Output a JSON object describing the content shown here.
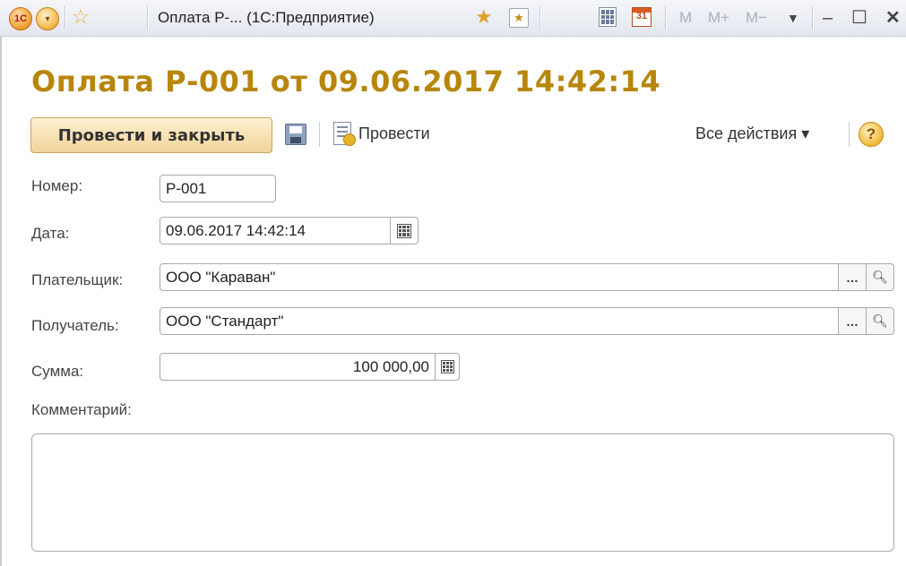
{
  "window": {
    "title": "Оплата Р-...  (1С:Предприятие)",
    "logo_text": "1С",
    "memory_buttons": [
      "M",
      "M+",
      "M−"
    ],
    "calendar_day": "31"
  },
  "form": {
    "title": "Оплата Р-001 от 09.06.2017 14:42:14",
    "toolbar": {
      "post_close_label": "Провести и закрыть",
      "post_label": "Провести",
      "all_actions_label": "Все действия ▾",
      "help_label": "?"
    },
    "fields": {
      "number_label": "Номер:",
      "number_value": "Р-001",
      "date_label": "Дата:",
      "date_value": "09.06.2017 14:42:14",
      "payer_label": "Плательщик:",
      "payer_value": "ООО \"Караван\"",
      "recipient_label": "Получатель:",
      "recipient_value": "ООО \"Стандарт\"",
      "sum_label": "Сумма:",
      "sum_value": "100 000,00",
      "comment_label": "Комментарий:",
      "comment_value": ""
    }
  },
  "colors": {
    "title_accent": "#b8860b",
    "primary_button": "#f2d49a"
  }
}
